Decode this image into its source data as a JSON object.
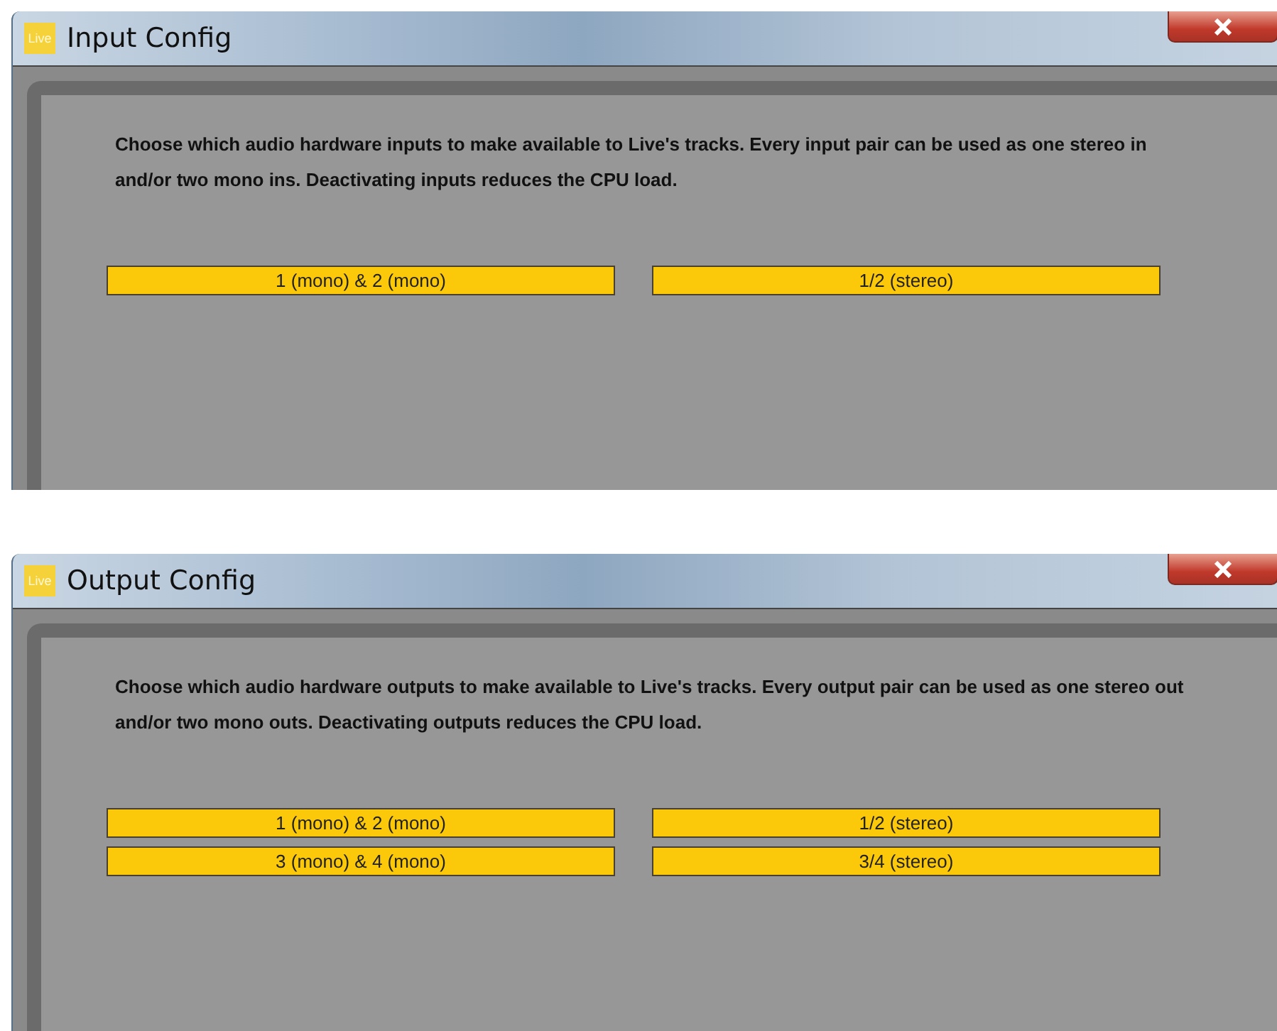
{
  "windows": [
    {
      "title": "Input Config",
      "logo_text": "Live",
      "description": "Choose which audio hardware inputs to make available to Live's tracks. Every input pair can be used as one stereo in and/or two mono ins.  Deactivating inputs reduces the CPU load.",
      "pairs": [
        {
          "mono": {
            "label": "1 (mono) & 2 (mono)",
            "on": true
          },
          "stereo": {
            "label": "1/2 (stereo)",
            "on": true
          }
        }
      ]
    },
    {
      "title": "Output Config",
      "logo_text": "Live",
      "description": "Choose which audio hardware outputs to make available to Live's tracks. Every output pair can be used as one stereo out and/or two mono outs.  Deactivating outputs reduces the CPU load.",
      "pairs": [
        {
          "mono": {
            "label": "1 (mono) & 2 (mono)",
            "on": true
          },
          "stereo": {
            "label": "1/2 (stereo)",
            "on": true
          }
        },
        {
          "mono": {
            "label": "3 (mono) & 4 (mono)",
            "on": true
          },
          "stereo": {
            "label": "3/4 (stereo)",
            "on": true
          }
        }
      ]
    }
  ]
}
